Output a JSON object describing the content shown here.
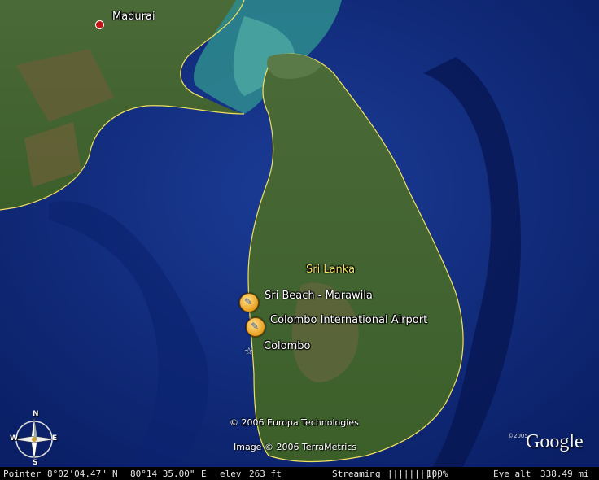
{
  "map": {
    "places": {
      "madurai": "Madurai",
      "country": "Sri Lanka",
      "sri_beach": "Sri Beach - Marawila",
      "airport": "Colombo International Airport",
      "colombo": "Colombo"
    },
    "copyright_1": "© 2006 Europa Technologies",
    "copyright_2": "Image © 2006 TerraMetrics",
    "logo": {
      "text": "Google",
      "year": "©2005"
    },
    "compass": {
      "n": "N",
      "s": "S",
      "e": "E",
      "w": "W"
    }
  },
  "status_bar": {
    "pointer_label": "Pointer",
    "lat": "8°02'04.47\"",
    "lat_dir": "N",
    "lon": "80°14'35.00\"",
    "lon_dir": "E",
    "elev_label": "elev",
    "elev_value": "263 ft",
    "streaming_label": "Streaming",
    "streaming_bar": "||||||||||",
    "streaming_percent": "100%",
    "eye_label": "Eye  alt",
    "eye_value": "338.49 mi"
  },
  "colors": {
    "ocean": "#0d2a7a",
    "land": "#3d6a2e",
    "border": "#f2e060"
  }
}
